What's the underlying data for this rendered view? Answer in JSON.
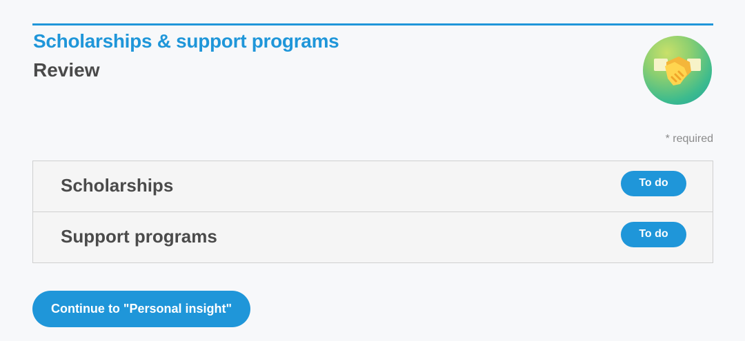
{
  "header": {
    "title": "Scholarships & support programs",
    "subtitle": "Review",
    "badge_icon": "handshake-icon"
  },
  "form": {
    "required_note": "* required"
  },
  "tasks": [
    {
      "label": "Scholarships",
      "status": "To do"
    },
    {
      "label": "Support programs",
      "status": "To do"
    }
  ],
  "actions": {
    "continue_label": "Continue to \"Personal insight\""
  },
  "colors": {
    "accent": "#1f96d9",
    "heading": "#4a4a4a",
    "muted": "#8a8a8a",
    "background": "#f7f8fa"
  }
}
